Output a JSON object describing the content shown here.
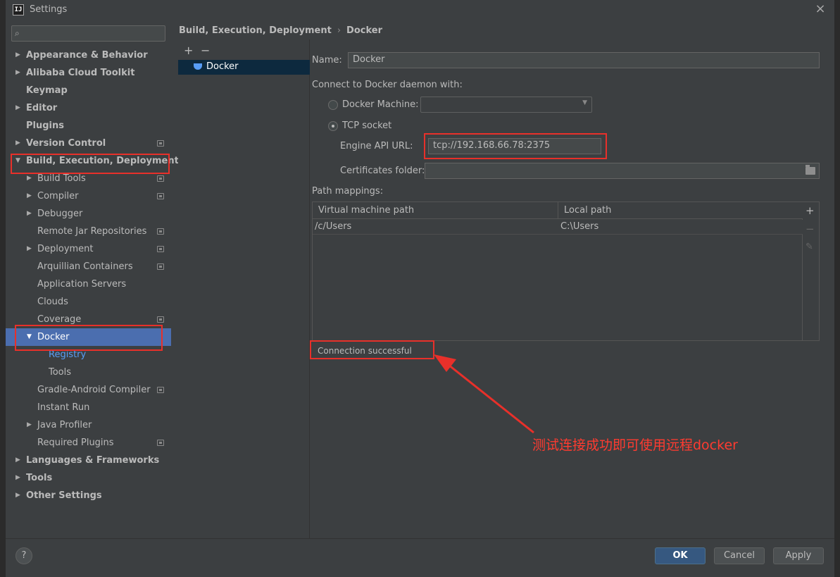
{
  "window": {
    "title": "Settings",
    "app_icon": "IJ"
  },
  "search": {
    "placeholder": "",
    "value": ""
  },
  "breadcrumb": {
    "parent": "Build, Execution, Deployment",
    "current": "Docker"
  },
  "tree": [
    {
      "label": "Appearance & Behavior",
      "level": 0,
      "bold": true,
      "arrow": "right",
      "proj": false
    },
    {
      "label": "Alibaba Cloud Toolkit",
      "level": 0,
      "bold": true,
      "arrow": "right",
      "proj": false
    },
    {
      "label": "Keymap",
      "level": 0,
      "bold": true,
      "arrow": "",
      "proj": false
    },
    {
      "label": "Editor",
      "level": 0,
      "bold": true,
      "arrow": "right",
      "proj": false
    },
    {
      "label": "Plugins",
      "level": 0,
      "bold": true,
      "arrow": "",
      "proj": false
    },
    {
      "label": "Version Control",
      "level": 0,
      "bold": true,
      "arrow": "right",
      "proj": true
    },
    {
      "label": "Build, Execution, Deployment",
      "level": 0,
      "bold": true,
      "arrow": "down",
      "proj": false
    },
    {
      "label": "Build Tools",
      "level": 1,
      "bold": false,
      "arrow": "right",
      "proj": true
    },
    {
      "label": "Compiler",
      "level": 1,
      "bold": false,
      "arrow": "right",
      "proj": true
    },
    {
      "label": "Debugger",
      "level": 1,
      "bold": false,
      "arrow": "right",
      "proj": false
    },
    {
      "label": "Remote Jar Repositories",
      "level": 1,
      "bold": false,
      "arrow": "",
      "proj": true
    },
    {
      "label": "Deployment",
      "level": 1,
      "bold": false,
      "arrow": "right",
      "proj": true
    },
    {
      "label": "Arquillian Containers",
      "level": 1,
      "bold": false,
      "arrow": "",
      "proj": true
    },
    {
      "label": "Application Servers",
      "level": 1,
      "bold": false,
      "arrow": "",
      "proj": false
    },
    {
      "label": "Clouds",
      "level": 1,
      "bold": false,
      "arrow": "",
      "proj": false
    },
    {
      "label": "Coverage",
      "level": 1,
      "bold": false,
      "arrow": "",
      "proj": true
    },
    {
      "label": "Docker",
      "level": 1,
      "bold": false,
      "arrow": "down",
      "proj": false,
      "selected": true
    },
    {
      "label": "Registry",
      "level": 2,
      "bold": false,
      "arrow": "",
      "proj": false,
      "link": true
    },
    {
      "label": "Tools",
      "level": 2,
      "bold": false,
      "arrow": "",
      "proj": false
    },
    {
      "label": "Gradle-Android Compiler",
      "level": 1,
      "bold": false,
      "arrow": "",
      "proj": true
    },
    {
      "label": "Instant Run",
      "level": 1,
      "bold": false,
      "arrow": "",
      "proj": false
    },
    {
      "label": "Java Profiler",
      "level": 1,
      "bold": false,
      "arrow": "right",
      "proj": false
    },
    {
      "label": "Required Plugins",
      "level": 1,
      "bold": false,
      "arrow": "",
      "proj": true
    },
    {
      "label": "Languages & Frameworks",
      "level": 0,
      "bold": true,
      "arrow": "right",
      "proj": false
    },
    {
      "label": "Tools",
      "level": 0,
      "bold": true,
      "arrow": "right",
      "proj": false
    },
    {
      "label": "Other Settings",
      "level": 0,
      "bold": true,
      "arrow": "right",
      "proj": false
    }
  ],
  "midlist": {
    "add": "+",
    "remove": "−",
    "items": [
      "Docker"
    ]
  },
  "form": {
    "name_label": "Name:",
    "name_value": "Docker",
    "connect_label": "Connect to Docker daemon with:",
    "docker_machine_label": "Docker Machine:",
    "docker_machine_value": "",
    "tcp_socket_label": "TCP socket",
    "selected_option": "tcp",
    "engine_api_label": "Engine API URL:",
    "engine_api_value": "tcp://192.168.66.78:2375",
    "certs_label": "Certificates folder:",
    "certs_value": "",
    "path_mappings_label": "Path mappings:"
  },
  "table": {
    "headers": [
      "Virtual machine path",
      "Local path"
    ],
    "rows": [
      [
        "/c/Users",
        "C:\\Users"
      ]
    ],
    "toolbar": {
      "add": "+",
      "remove": "−",
      "edit": "✎"
    }
  },
  "status": {
    "message": "Connection successful"
  },
  "annotation": {
    "text": "测试连接成功即可使用远程docker",
    "color": "#ff3b30"
  },
  "footer": {
    "help": "?",
    "ok": "OK",
    "cancel": "Cancel",
    "apply": "Apply"
  },
  "colors": {
    "selection": "#4b6eaf",
    "link": "#589df6",
    "ok_button": "#365880",
    "annotation_red": "#e8302a"
  }
}
